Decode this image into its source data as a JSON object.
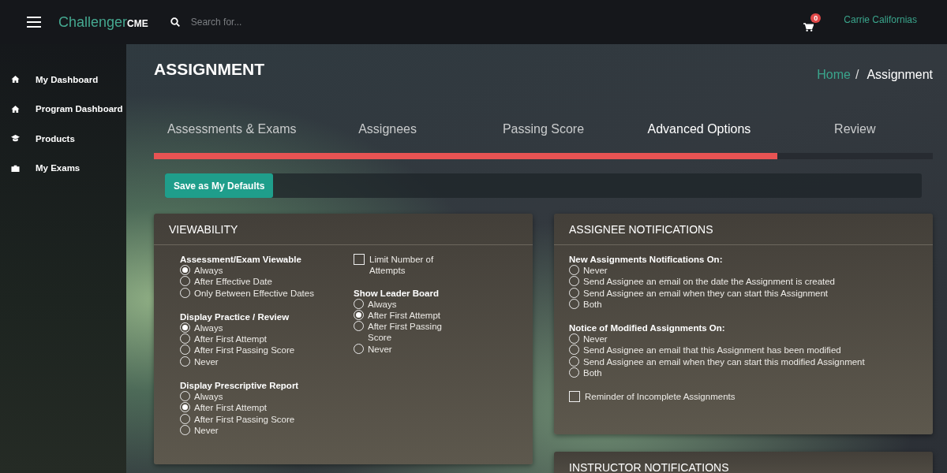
{
  "header": {
    "brand": {
      "name": "Challenger",
      "suffix": "CME"
    },
    "search": {
      "placeholder": "Search for..."
    },
    "cart": {
      "count": "0"
    },
    "user": "Carrie Californias"
  },
  "sidebar": {
    "items": [
      {
        "label": "My Dashboard"
      },
      {
        "label": "Program Dashboard"
      },
      {
        "label": "Products"
      },
      {
        "label": "My Exams"
      }
    ]
  },
  "page": {
    "title": "ASSIGNMENT",
    "breadcrumb": {
      "link": "Home",
      "separator": "/",
      "current": "Assignment"
    }
  },
  "tabs": [
    {
      "label": "Assessments & Exams",
      "selected": false
    },
    {
      "label": "Assignees",
      "selected": false
    },
    {
      "label": "Passing Score",
      "selected": false
    },
    {
      "label": "Advanced Options",
      "selected": true
    },
    {
      "label": "Review",
      "selected": false
    }
  ],
  "progress": {
    "level": 0.8
  },
  "defaults_button": "Save as My Defaults",
  "viewability": {
    "title": "VIEWABILITY",
    "columns": [
      [
        {
          "kind": "radio",
          "label": "Assessment/Exam Viewable",
          "options": [
            {
              "label": "Always",
              "selected": true
            },
            {
              "label": "After Effective Date",
              "selected": false
            },
            {
              "label": "Only Between Effective Dates",
              "selected": false
            }
          ]
        },
        {
          "kind": "radio",
          "label": "Display Practice / Review",
          "options": [
            {
              "label": "Always",
              "selected": true
            },
            {
              "label": "After First Attempt",
              "selected": false
            },
            {
              "label": "After First Passing Score",
              "selected": false
            },
            {
              "label": "Never",
              "selected": false
            }
          ]
        },
        {
          "kind": "radio",
          "label": "Display Prescriptive Report",
          "options": [
            {
              "label": "Always",
              "selected": false
            },
            {
              "label": "After First Attempt",
              "selected": true
            },
            {
              "label": "After First Passing Score",
              "selected": false
            },
            {
              "label": "Never",
              "selected": false
            }
          ]
        }
      ],
      [
        {
          "kind": "checkbox",
          "label": "Limit Number of Attempts",
          "checked": false
        },
        {
          "kind": "radio",
          "label": "Show Leader Board",
          "options": [
            {
              "label": "Always",
              "selected": false
            },
            {
              "label": "After First Attempt",
              "selected": true
            },
            {
              "label": "After First Passing Score",
              "selected": false
            },
            {
              "label": "Never",
              "selected": false
            }
          ]
        }
      ]
    ]
  },
  "assignee_notifications": {
    "title": "ASSIGNEE NOTIFICATIONS",
    "groups": [
      {
        "kind": "radio",
        "label": "New Assignments Notifications On:",
        "options": [
          {
            "label": "Never",
            "selected": false
          },
          {
            "label": "Send Assignee an email on the date the Assignment is created",
            "selected": false
          },
          {
            "label": "Send Assignee an email when they can start this Assignment",
            "selected": false
          },
          {
            "label": "Both",
            "selected": false
          }
        ]
      },
      {
        "kind": "radio",
        "label": "Notice of Modified Assignments On:",
        "options": [
          {
            "label": "Never",
            "selected": false
          },
          {
            "label": "Send Assignee an email that this Assignment has been modified",
            "selected": false
          },
          {
            "label": "Send Assignee an email when they can start this modified Assignment",
            "selected": false
          },
          {
            "label": "Both",
            "selected": false
          }
        ]
      },
      {
        "kind": "checkbox",
        "label": "Reminder of Incomplete Assignments",
        "checked": false
      }
    ]
  },
  "instructor_notifications": {
    "title": "INSTRUCTOR NOTIFICATIONS"
  }
}
